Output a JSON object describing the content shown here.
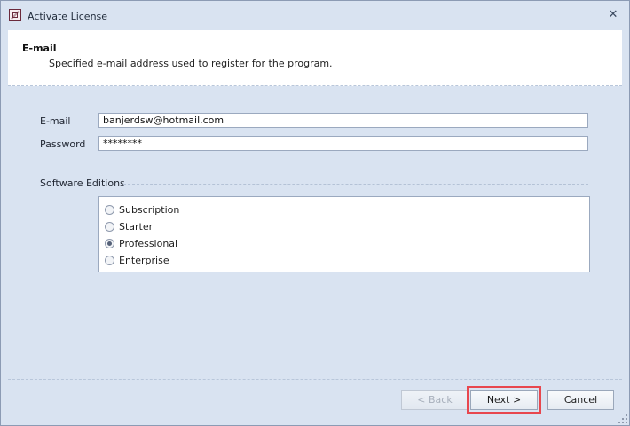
{
  "window": {
    "title": "Activate License",
    "close_symbol": "✕"
  },
  "header": {
    "title": "E-mail",
    "description": "Specified e-mail address used to register for the program."
  },
  "form": {
    "email_label": "E-mail",
    "email_value": "banjerdsw@hotmail.com",
    "password_label": "Password",
    "password_value": "********"
  },
  "editions": {
    "label": "Software Editions",
    "options": [
      {
        "label": "Subscription",
        "checked": false
      },
      {
        "label": "Starter",
        "checked": false
      },
      {
        "label": "Professional",
        "checked": true
      },
      {
        "label": "Enterprise",
        "checked": false
      }
    ]
  },
  "buttons": {
    "back": "< Back",
    "next": "Next >",
    "cancel": "Cancel"
  },
  "colors": {
    "window_bg": "#d9e3f1",
    "header_bg": "#ffffff",
    "highlight_border": "#e8474e"
  },
  "icons": {
    "app": "license-app-icon",
    "close": "close-icon",
    "resize": "resize-grip-icon"
  }
}
